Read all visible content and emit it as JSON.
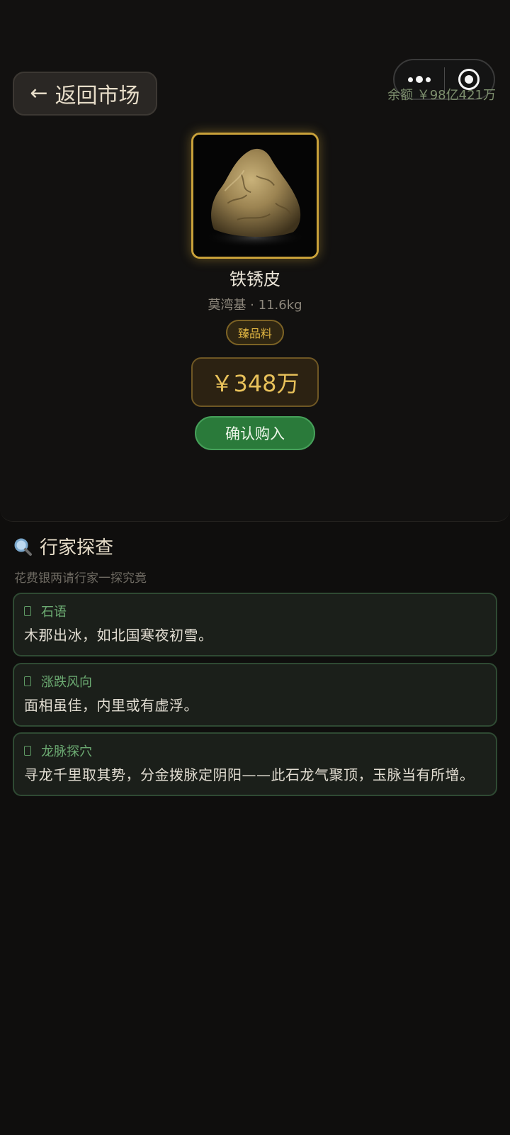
{
  "header": {
    "back_label": "返回市场",
    "back_arrow": "←",
    "balance_label": "余额",
    "balance_value": "￥98亿421万"
  },
  "stone": {
    "name": "铁锈皮",
    "meta": "莫湾基 · 11.6kg",
    "grade": "臻品料",
    "price": "￥348万",
    "buy_label": "确认购入"
  },
  "expert": {
    "title": "行家探查",
    "subtitle": "花费银两请行家一探究竟",
    "cards": [
      {
        "label": "石语",
        "text": "木那出冰，如北国寒夜初雪。"
      },
      {
        "label": "涨跌风向",
        "text": "面相虽佳，内里或有虚浮。"
      },
      {
        "label": "龙脉探穴",
        "text": "寻龙千里取其势，分金拨脉定阴阳——此石龙气聚顶，玉脉当有所增。"
      }
    ]
  },
  "colors": {
    "accent_gold": "#c9a13a",
    "buy_green": "#2a7a3a",
    "card_border": "#2f4a33"
  }
}
